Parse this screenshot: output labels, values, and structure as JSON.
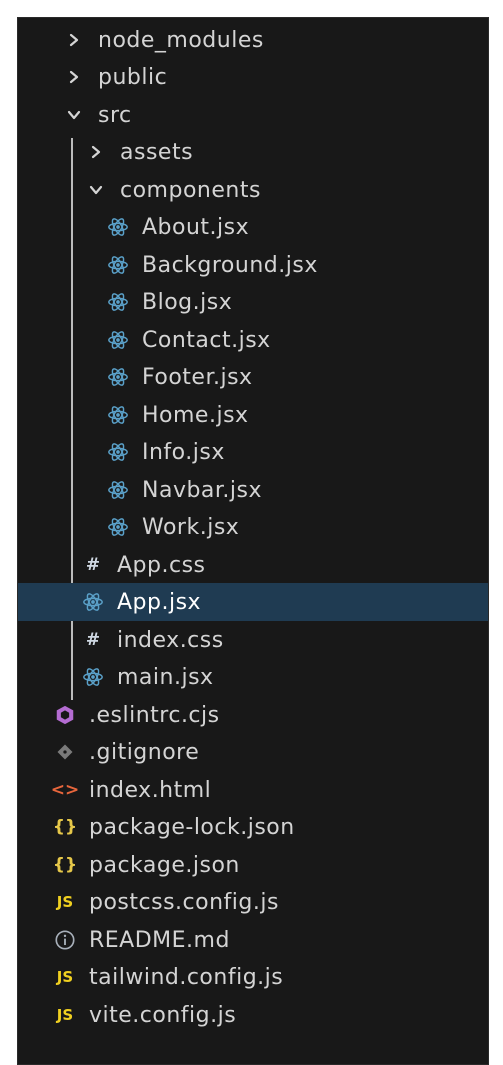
{
  "explorer": {
    "items": [
      {
        "label": "node_modules",
        "icon": "chevron-right-icon"
      },
      {
        "label": "public",
        "icon": "chevron-right-icon"
      },
      {
        "label": "src",
        "icon": "chevron-down-icon"
      },
      {
        "label": "assets",
        "icon": "chevron-right-icon"
      },
      {
        "label": "components",
        "icon": "chevron-down-icon"
      },
      {
        "label": "About.jsx",
        "icon": "react-icon"
      },
      {
        "label": "Background.jsx",
        "icon": "react-icon"
      },
      {
        "label": "Blog.jsx",
        "icon": "react-icon"
      },
      {
        "label": "Contact.jsx",
        "icon": "react-icon"
      },
      {
        "label": "Footer.jsx",
        "icon": "react-icon"
      },
      {
        "label": "Home.jsx",
        "icon": "react-icon"
      },
      {
        "label": "Info.jsx",
        "icon": "react-icon"
      },
      {
        "label": "Navbar.jsx",
        "icon": "react-icon"
      },
      {
        "label": "Work.jsx",
        "icon": "react-icon"
      },
      {
        "label": "App.css",
        "icon": "css-hash-icon",
        "glyph": "#"
      },
      {
        "label": "App.jsx",
        "icon": "react-icon",
        "selected": true
      },
      {
        "label": "index.css",
        "icon": "css-hash-icon",
        "glyph": "#"
      },
      {
        "label": "main.jsx",
        "icon": "react-icon"
      },
      {
        "label": ".eslintrc.cjs",
        "icon": "eslint-icon"
      },
      {
        "label": ".gitignore",
        "icon": "git-icon"
      },
      {
        "label": "index.html",
        "icon": "html-icon",
        "glyph": "<>"
      },
      {
        "label": "package-lock.json",
        "icon": "json-icon",
        "glyph": "{}"
      },
      {
        "label": "package.json",
        "icon": "json-icon",
        "glyph": "{}"
      },
      {
        "label": "postcss.config.js",
        "icon": "js-icon",
        "glyph": "JS"
      },
      {
        "label": "README.md",
        "icon": "info-icon"
      },
      {
        "label": "tailwind.config.js",
        "icon": "js-icon",
        "glyph": "JS"
      },
      {
        "label": "vite.config.js",
        "icon": "js-icon",
        "glyph": "JS"
      }
    ]
  },
  "colors": {
    "background": "#181818",
    "text": "#d4d4d4",
    "selected_row": "#1f3b52",
    "react": "#5aa0c8",
    "css_hash": "#cfd8e3",
    "eslint": "#b46cd2",
    "git": "#7a7a7a",
    "html": "#e8663c",
    "json": "#e6c84a",
    "js": "#f0d020",
    "info": "#a8b0ba",
    "indent_guide": "#bcbcbc"
  }
}
